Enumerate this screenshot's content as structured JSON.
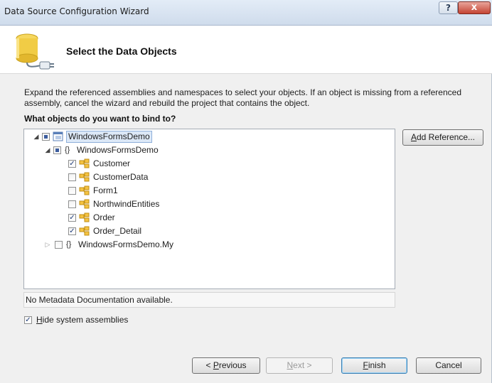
{
  "window": {
    "title": "Data Source Configuration Wizard",
    "help_glyph": "?",
    "close_glyph": "x"
  },
  "header": {
    "title": "Select the Data Objects",
    "icon": "database-plug-icon"
  },
  "description": "Expand the referenced assemblies and namespaces to select your objects. If an object is missing from a referenced assembly, cancel the wizard and rebuild the project that contains the object.",
  "question": "What objects do you want to bind to?",
  "tree": {
    "nodes": [
      {
        "label": "WindowsFormsDemo",
        "level": 0,
        "expanded": true,
        "checked": "partial",
        "icon": "project-icon",
        "selected": true
      },
      {
        "label": "WindowsFormsDemo",
        "level": 1,
        "expanded": true,
        "checked": "partial",
        "icon": "namespace-icon"
      },
      {
        "label": "Customer",
        "level": 2,
        "checked": "checked",
        "icon": "class-icon"
      },
      {
        "label": "CustomerData",
        "level": 2,
        "checked": "unchecked",
        "icon": "class-icon"
      },
      {
        "label": "Form1",
        "level": 2,
        "checked": "unchecked",
        "icon": "class-icon"
      },
      {
        "label": "NorthwindEntities",
        "level": 2,
        "checked": "unchecked",
        "icon": "class-icon"
      },
      {
        "label": "Order",
        "level": 2,
        "checked": "checked",
        "icon": "class-icon"
      },
      {
        "label": "Order_Detail",
        "level": 2,
        "checked": "checked",
        "icon": "class-icon"
      },
      {
        "label": "WindowsFormsDemo.My",
        "level": 1,
        "expanded": false,
        "checked": "unchecked",
        "icon": "namespace-icon"
      }
    ],
    "namespace_glyph": "{}"
  },
  "add_reference": {
    "prefix": "A",
    "rest": "dd Reference..."
  },
  "metadata_text": "No Metadata Documentation available.",
  "hide_system": {
    "checked": true,
    "prefix": "H",
    "rest": "ide system assemblies"
  },
  "buttons": {
    "previous": {
      "before": "< ",
      "mnemonic": "P",
      "after": "revious"
    },
    "next": {
      "mnemonic": "N",
      "after": "ext >"
    },
    "finish": {
      "mnemonic": "F",
      "after": "inish"
    },
    "cancel": "Cancel"
  },
  "colors": {
    "accent": "#3c7fb1",
    "selection": "#dce8f7",
    "close": "#c44433"
  }
}
